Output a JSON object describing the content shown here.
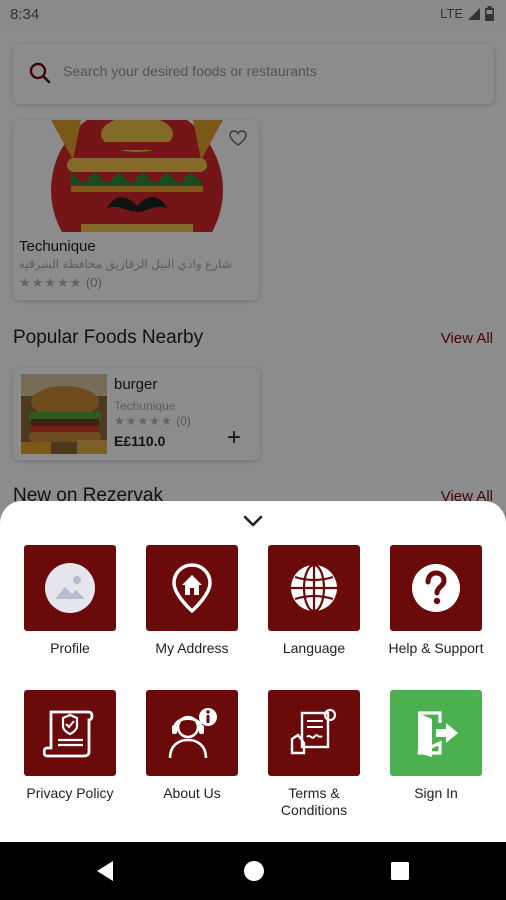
{
  "status_bar": {
    "time": "8:34",
    "network": "LTE"
  },
  "search": {
    "placeholder": "Search your desired foods or restaurants",
    "icon": "search-icon"
  },
  "restaurant": {
    "name": "Techunique",
    "address": "شارع وادي النيل الزقازيق محافظة الشرقية",
    "stars": "★★★★★",
    "review_count": "(0)",
    "logo": "sombrero-mustache-logo"
  },
  "popular": {
    "title": "Popular Foods Nearby",
    "view_all": "View All",
    "items": [
      {
        "name": "burger",
        "restaurant": "Techunique",
        "stars": "★★★★★",
        "review_count": "(0)",
        "price": "E£110.0",
        "add_label": "+"
      }
    ]
  },
  "new_section": {
    "title": "New on Rezervak",
    "view_all": "View All"
  },
  "menu": {
    "items": [
      {
        "label": "Profile",
        "icon": "profile-placeholder-icon",
        "color": "#6b0a0a"
      },
      {
        "label": "My Address",
        "icon": "location-home-icon",
        "color": "#6b0a0a"
      },
      {
        "label": "Language",
        "icon": "globe-icon",
        "color": "#6b0a0a"
      },
      {
        "label": "Help & Support",
        "icon": "question-icon",
        "color": "#6b0a0a"
      },
      {
        "label": "Privacy Policy",
        "icon": "privacy-policy-icon",
        "color": "#6b0a0a"
      },
      {
        "label": "About Us",
        "icon": "support-agent-icon",
        "color": "#6b0a0a"
      },
      {
        "label": "Terms & Conditions",
        "icon": "terms-document-icon",
        "color": "#6b0a0a"
      },
      {
        "label": "Sign In",
        "icon": "sign-in-door-icon",
        "color": "#4caf50"
      }
    ]
  },
  "colors": {
    "brand": "#6b0a0a",
    "accent_link": "#7a0a0a",
    "sign_in": "#4caf50",
    "sheet": "#ffffff"
  }
}
